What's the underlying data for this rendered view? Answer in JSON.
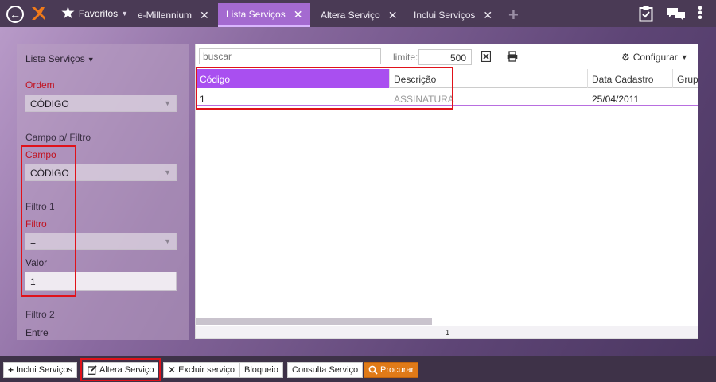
{
  "topbar": {
    "favorites_label": "Favoritos",
    "tabs": [
      {
        "label": "e-Millennium",
        "active": false
      },
      {
        "label": "Lista Serviços",
        "active": true
      },
      {
        "label": "Altera Serviço",
        "active": false
      },
      {
        "label": "Inclui Serviços",
        "active": false
      }
    ],
    "close_glyph": "✕",
    "add_tab_glyph": "+"
  },
  "left_panel": {
    "title": "Lista Serviços",
    "ordem_label": "Ordem",
    "ordem_value": "CÓDIGO",
    "campo_filtro_section": "Campo p/ Filtro",
    "campo_label": "Campo",
    "campo_value": "CÓDIGO",
    "filtro1_section": "Filtro 1",
    "filtro_label": "Filtro",
    "filtro_value": "=",
    "valor_label": "Valor",
    "valor_value": "1",
    "filtro2_section": "Filtro 2",
    "entre_label": "Entre"
  },
  "main": {
    "search_placeholder": "buscar",
    "limite_label": "limite:",
    "limite_value": "500",
    "configurar_label": "Configurar",
    "columns": [
      "Código",
      "Descrição",
      "Data Cadastro",
      "Grup"
    ],
    "rows": [
      {
        "codigo": "1",
        "descricao": "ASSINATURA",
        "data": "25/04/2011"
      }
    ],
    "page": "1"
  },
  "bottom_toolbar": {
    "buttons": [
      {
        "label": "Inclui Serviços",
        "icon": "plus-icon"
      },
      {
        "label": "Altera Serviço",
        "icon": "edit-icon"
      },
      {
        "label": "Excluir serviço",
        "icon": "close-icon"
      },
      {
        "label": "Bloqueio",
        "icon": ""
      },
      {
        "label": "Consulta Serviço",
        "icon": ""
      },
      {
        "label": "Procurar",
        "icon": "search-icon"
      }
    ]
  },
  "colors": {
    "accent": "#a94ff0",
    "highlight": "#e0121a",
    "procurar": "#e07a18",
    "topbar": "#4a3a55"
  }
}
